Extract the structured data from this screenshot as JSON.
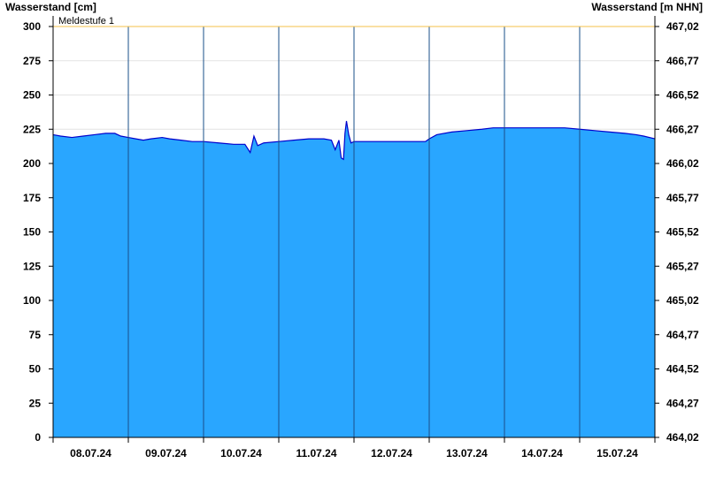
{
  "chart_data": {
    "type": "area",
    "ylabel_left": "Wasserstand [cm]",
    "ylabel_right": "Wasserstand [m NHN]",
    "ylim": [
      0,
      300
    ],
    "yticks_left": [
      0,
      25,
      50,
      75,
      100,
      125,
      150,
      175,
      200,
      225,
      250,
      275,
      300
    ],
    "yticks_right": [
      "464,02",
      "464,27",
      "464,52",
      "464,77",
      "465,02",
      "465,27",
      "465,52",
      "465,77",
      "466,02",
      "466,27",
      "466,52",
      "466,77",
      "467,02"
    ],
    "x_days": [
      "08.07.24",
      "09.07.24",
      "10.07.24",
      "11.07.24",
      "12.07.24",
      "13.07.24",
      "14.07.24",
      "15.07.24"
    ],
    "grid": true,
    "threshold": {
      "label": "Meldestufe 1",
      "value": 300,
      "color": "#f5c04a"
    },
    "fill_color": "#29a6ff",
    "line_color": "#0000cc",
    "series": [
      {
        "x": [
          0,
          0.1,
          0.25,
          0.4,
          0.55,
          0.7,
          0.82,
          0.9,
          1.0,
          1.1,
          1.2,
          1.3,
          1.45,
          1.55,
          1.7,
          1.85,
          2.0,
          2.2,
          2.4,
          2.55,
          2.62,
          2.67,
          2.72,
          2.8,
          3.0,
          3.2,
          3.4,
          3.6,
          3.7,
          3.75,
          3.8,
          3.83,
          3.86,
          3.88,
          3.9,
          3.93,
          3.96,
          4.0,
          4.2,
          4.4,
          4.6,
          4.8,
          4.95,
          5.0,
          5.1,
          5.3,
          5.5,
          5.7,
          5.85,
          6.0,
          6.2,
          6.4,
          6.6,
          6.8,
          7.0,
          7.2,
          7.4,
          7.6,
          7.75,
          7.85,
          8.0
        ],
        "y": [
          221,
          220,
          219,
          220,
          221,
          222,
          222,
          220,
          219,
          218,
          217,
          218,
          219,
          218,
          217,
          216,
          216,
          215,
          214,
          214,
          208,
          220,
          213,
          215,
          216,
          217,
          218,
          218,
          217,
          210,
          217,
          204,
          203,
          222,
          231,
          221,
          215,
          216,
          216,
          216,
          216,
          216,
          216,
          218,
          221,
          223,
          224,
          225,
          226,
          226,
          226,
          226,
          226,
          226,
          225,
          224,
          223,
          222,
          221,
          220,
          218
        ]
      }
    ]
  }
}
